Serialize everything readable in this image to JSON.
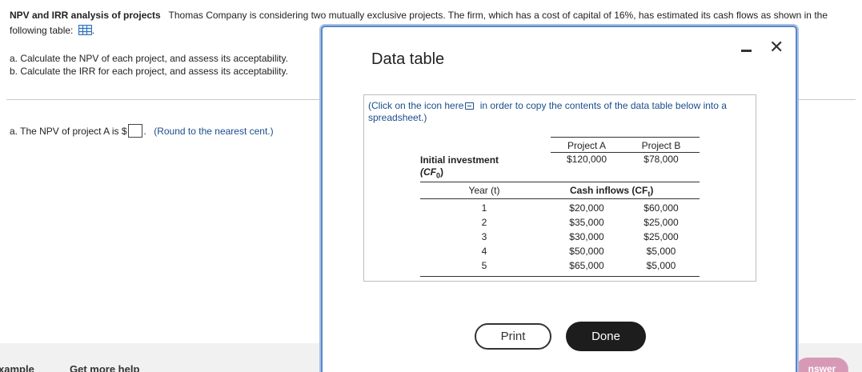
{
  "problem": {
    "title": "NPV and IRR analysis of projects",
    "text": "Thomas Company is considering two mutually exclusive projects. The firm, which has a cost of capital of 16%, has estimated its cash flows as shown in the following table:",
    "text_end": ".",
    "part_a": "a. Calculate the NPV of each project, and assess its acceptability.",
    "part_b": "b. Calculate the IRR for each project, and assess its acceptability."
  },
  "answer": {
    "prompt": "a. The NPV of project A is $",
    "end": ".",
    "hint": "(Round to the nearest cent.)"
  },
  "footer": {
    "example": "xample",
    "help": "Get more help",
    "answer_button": "nswer"
  },
  "modal": {
    "title": "Data table",
    "note_pre": "(Click on the icon here",
    "note_post": "in order to copy the contents of the data table below into a spreadsheet.)",
    "table": {
      "col_a": "Project A",
      "col_b": "Project B",
      "initial_label": "Initial investment",
      "initial_sub": "(CF",
      "initial_sub_index": "0",
      "initial_sub_end": ")",
      "initial_a": "$120,000",
      "initial_b": "$78,000",
      "year_label": "Year (t)",
      "cash_label": "Cash inflows (CF",
      "cash_label_index": "t",
      "cash_label_end": ")",
      "rows": [
        {
          "year": "1",
          "a": "$20,000",
          "b": "$60,000"
        },
        {
          "year": "2",
          "a": "$35,000",
          "b": "$25,000"
        },
        {
          "year": "3",
          "a": "$30,000",
          "b": "$25,000"
        },
        {
          "year": "4",
          "a": "$50,000",
          "b": "$5,000"
        },
        {
          "year": "5",
          "a": "$65,000",
          "b": "$5,000"
        }
      ]
    },
    "print_label": "Print",
    "done_label": "Done"
  }
}
